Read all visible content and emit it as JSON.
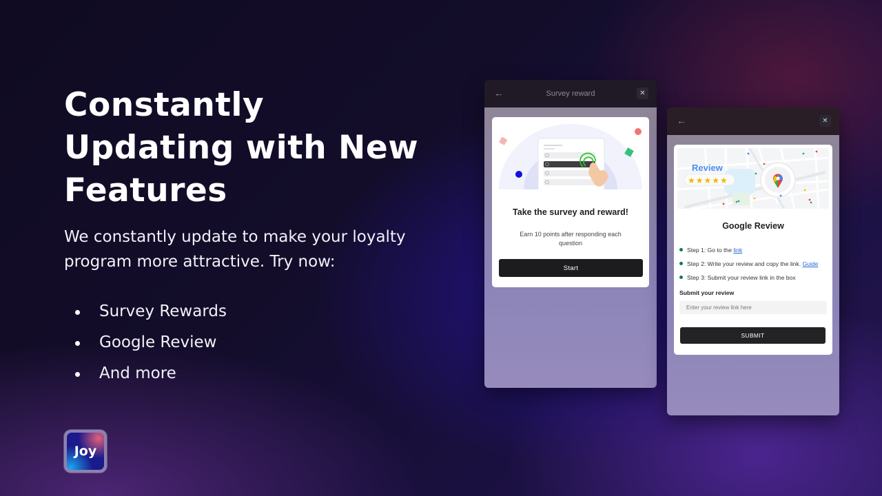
{
  "hero": {
    "headline_lines": [
      "Constantly",
      "Updating with New",
      "Features"
    ],
    "subtext": "We constantly update to make your loyalty program more attractive. Try now:",
    "bullets": [
      "Survey Rewards",
      "Google Review",
      "And more"
    ]
  },
  "logo": {
    "text": "Joy",
    "icon": "joy-app-logo"
  },
  "survey_panel": {
    "title": "Survey reward",
    "back_icon": "arrow-left-icon",
    "close_icon": "close-icon",
    "back_glyph": "←",
    "close_glyph": "✕",
    "card_title": "Take the survey and reward!",
    "card_description": "Earn 10 points after responding each question",
    "start_button": "Start",
    "illustration": "survey-form-with-hand-tap"
  },
  "google_panel": {
    "back_glyph": "←",
    "close_glyph": "✕",
    "map_badge": "Review",
    "stars": 5,
    "star_glyphs": "★★★★★",
    "card_title": "Google Review",
    "steps": [
      {
        "text": "Step 1: Go to the ",
        "link": "link"
      },
      {
        "text": "Step 2: Write your review and copy the link. ",
        "link": "Guide"
      },
      {
        "text": "Step 3: Submit your review link in the box",
        "link": ""
      }
    ],
    "submit_label": "Submit your review",
    "input_placeholder": "Enter your review link here",
    "input_value": "",
    "submit_button": "SUBMIT"
  },
  "colors": {
    "accent_green": "#0c7a5a",
    "link_blue": "#2166d9",
    "button_dark": "#1c1c1e",
    "review_blue": "#4a8df0",
    "star_yellow": "#f5b400"
  }
}
